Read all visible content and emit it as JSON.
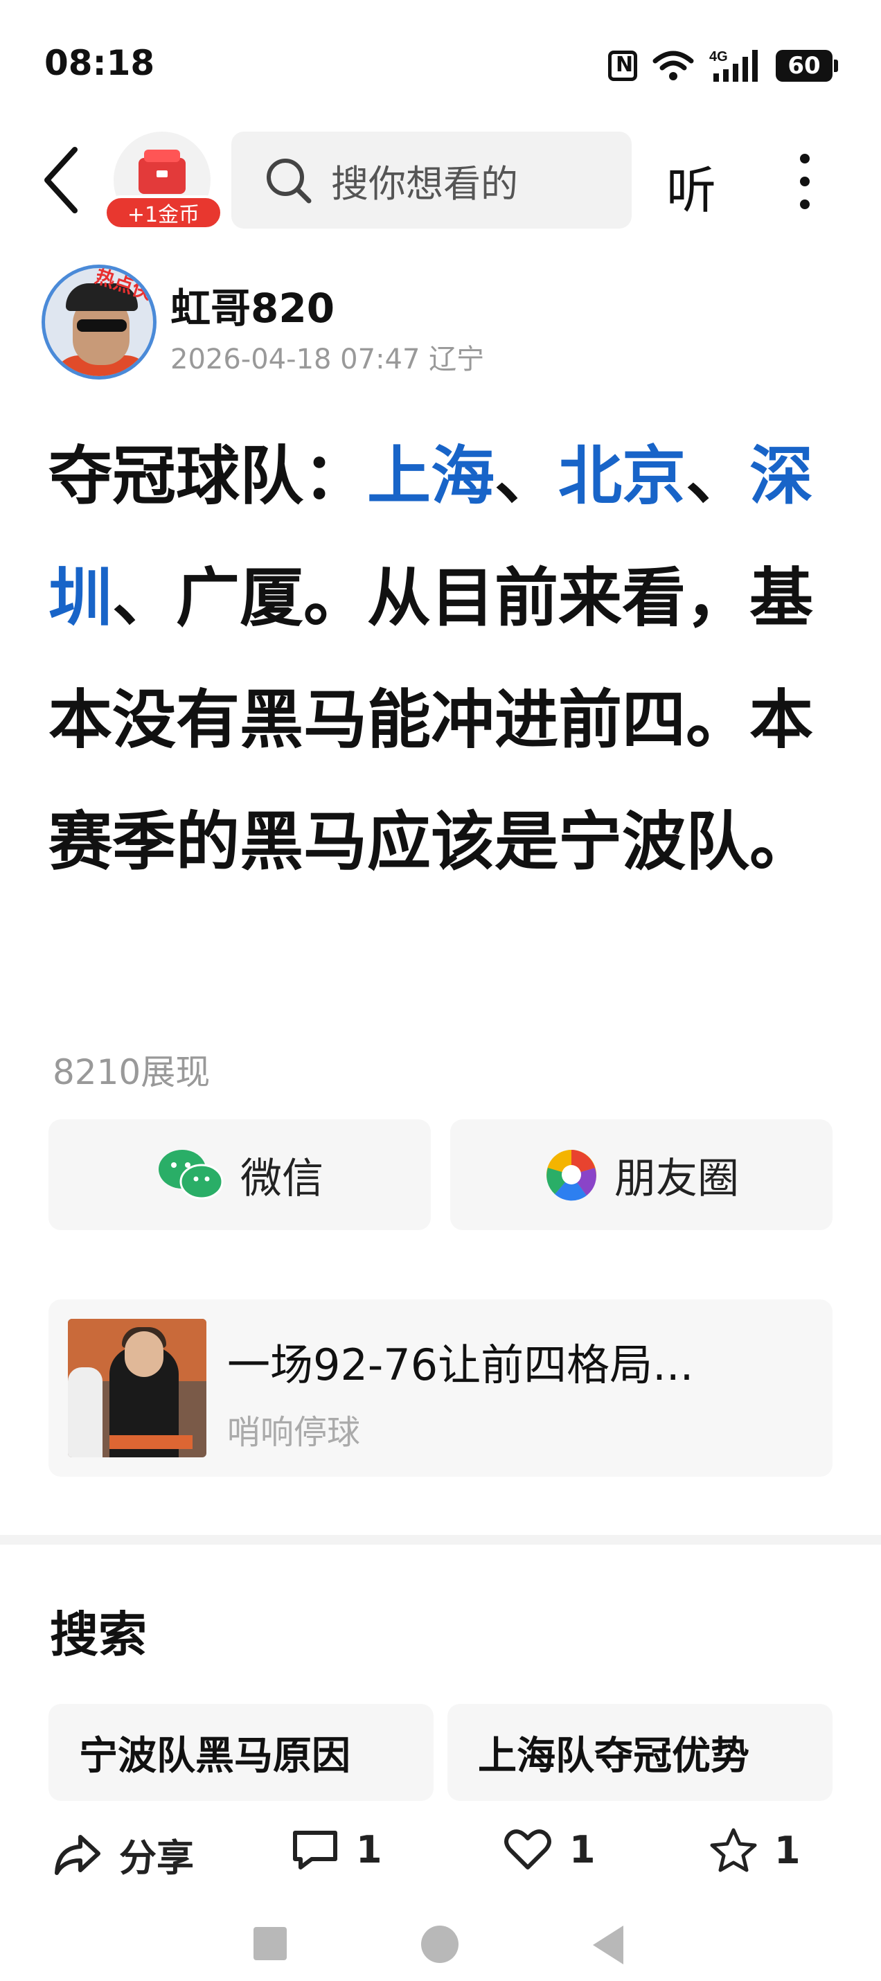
{
  "status_bar": {
    "time": "08:18",
    "network": "4G",
    "battery": "60",
    "icons": [
      "nfc-icon",
      "wifi-icon",
      "signal-icon",
      "battery-icon"
    ]
  },
  "top_nav": {
    "coin_label": "+1金币",
    "search_placeholder": "搜你想看的",
    "listen_label": "听",
    "icons": [
      "back-icon",
      "gift-icon",
      "search-icon",
      "more-icon"
    ]
  },
  "author": {
    "name": "虹哥820",
    "meta": "2026-04-18 07:47 辽宁",
    "avatar_tag": "热点侠"
  },
  "article": {
    "prefix": "夺冠球队：",
    "link1": "上海",
    "sep1": "、",
    "link2": "北京",
    "sep2": "、",
    "link3": "深圳",
    "rest": "、广厦。从目前来看，基本没有黑马能冲进前四。本赛季的黑马应该是宁波队。",
    "link_color": "#1864c8"
  },
  "views": "8210展现",
  "share": {
    "wechat_label": "微信",
    "moments_label": "朋友圈"
  },
  "related": {
    "title": "一场92-76让前四格局...",
    "source": "哨响停球"
  },
  "search_section": {
    "heading": "搜索",
    "tags": [
      "宁波队黑马原因",
      "上海队夺冠优势"
    ]
  },
  "bottom_actions": {
    "share_label": "分享",
    "comment_count": "1",
    "like_count": "1",
    "favorite_count": "1"
  }
}
